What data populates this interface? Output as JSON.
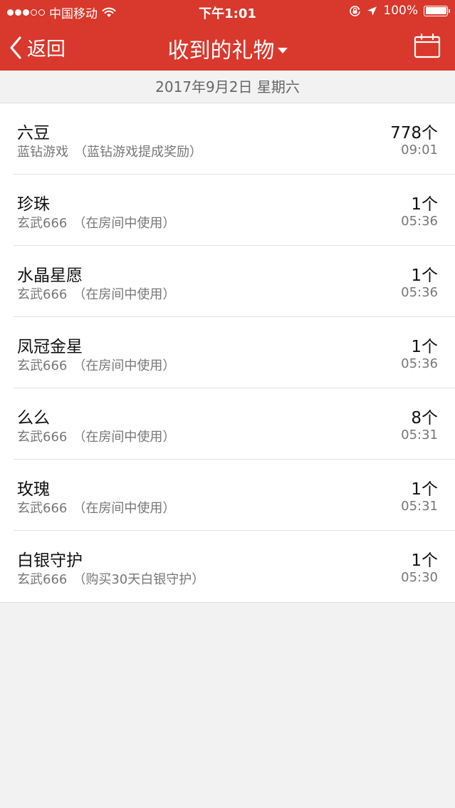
{
  "status_bar": {
    "carrier": "中国移动",
    "time": "下午1:01",
    "battery": "100%",
    "battery_level": 1.0
  },
  "nav": {
    "back_label": "返回",
    "title": "收到的礼物"
  },
  "date_header": "2017年9月2日 星期六",
  "gifts": [
    {
      "name": "六豆",
      "sender": "蓝钻游戏",
      "reason": "（蓝钻游戏提成奖励）",
      "count": "778个",
      "time": "09:01"
    },
    {
      "name": "珍珠",
      "sender": "玄武666",
      "reason": "（在房间中使用）",
      "count": "1个",
      "time": "05:36"
    },
    {
      "name": "水晶星愿",
      "sender": "玄武666",
      "reason": "（在房间中使用）",
      "count": "1个",
      "time": "05:36"
    },
    {
      "name": "凤冠金星",
      "sender": "玄武666",
      "reason": "（在房间中使用）",
      "count": "1个",
      "time": "05:36"
    },
    {
      "name": "么么",
      "sender": "玄武666",
      "reason": "（在房间中使用）",
      "count": "8个",
      "time": "05:31"
    },
    {
      "name": "玫瑰",
      "sender": "玄武666",
      "reason": "（在房间中使用）",
      "count": "1个",
      "time": "05:31"
    },
    {
      "name": "白银守护",
      "sender": "玄武666",
      "reason": "（购买30天白银守护）",
      "count": "1个",
      "time": "05:30"
    }
  ],
  "colors": {
    "brand_red": "#d9382c",
    "background": "#f2f2f2"
  },
  "icons": {
    "back": "chevron-left-icon",
    "title_dropdown": "caret-down-icon",
    "calendar": "calendar-icon",
    "wifi": "wifi-icon",
    "orientation_lock": "orientation-lock-icon",
    "location": "location-arrow-icon",
    "battery": "battery-icon"
  }
}
